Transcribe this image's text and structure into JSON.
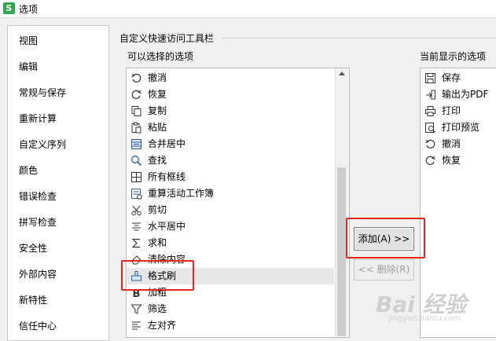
{
  "window": {
    "title": "选项",
    "app_icon_glyph": "S",
    "app_icon_color": "#2fa84f"
  },
  "sidebar": {
    "items": [
      {
        "label": "视图"
      },
      {
        "label": "编辑"
      },
      {
        "label": "常规与保存"
      },
      {
        "label": "重新计算"
      },
      {
        "label": "自定义序列"
      },
      {
        "label": "颜色"
      },
      {
        "label": "错误检查"
      },
      {
        "label": "拼写检查"
      },
      {
        "label": "安全性"
      },
      {
        "label": "外部内容"
      },
      {
        "label": "新特性"
      },
      {
        "label": "信任中心"
      }
    ]
  },
  "panel": {
    "group_title": "自定义快速访问工具栏",
    "available_label": "可以选择的选项",
    "current_label": "当前显示的选项",
    "available_items": [
      {
        "label": "撤消",
        "icon": "undo-icon"
      },
      {
        "label": "恢复",
        "icon": "redo-icon"
      },
      {
        "label": "复制",
        "icon": "copy-icon"
      },
      {
        "label": "粘贴",
        "icon": "paste-icon"
      },
      {
        "label": "合并居中",
        "icon": "merge-center-icon"
      },
      {
        "label": "查找",
        "icon": "search-icon"
      },
      {
        "label": "所有框线",
        "icon": "all-borders-icon"
      },
      {
        "label": "重算活动工作簿",
        "icon": "recalculate-icon"
      },
      {
        "label": "剪切",
        "icon": "cut-icon"
      },
      {
        "label": "水平居中",
        "icon": "align-center-icon"
      },
      {
        "label": "求和",
        "icon": "sum-icon"
      },
      {
        "label": "清除内容",
        "icon": "clear-content-icon"
      },
      {
        "label": "格式刷",
        "icon": "format-painter-icon"
      },
      {
        "label": "加粗",
        "icon": "bold-icon"
      },
      {
        "label": "筛选",
        "icon": "filter-icon"
      },
      {
        "label": "左对齐",
        "icon": "align-left-icon"
      }
    ],
    "current_items": [
      {
        "label": "保存",
        "icon": "save-icon"
      },
      {
        "label": "输出为PDF",
        "icon": "export-pdf-icon"
      },
      {
        "label": "打印",
        "icon": "print-icon"
      },
      {
        "label": "打印预览",
        "icon": "print-preview-icon"
      },
      {
        "label": "撤消",
        "icon": "undo-icon"
      },
      {
        "label": "恢复",
        "icon": "redo-icon"
      }
    ],
    "add_button": "添加(A) >>",
    "remove_button": "<< 删除(R)"
  },
  "watermark": {
    "text": "Bai 经验",
    "sub": "jingyan.baidu.com"
  },
  "colors": {
    "highlight": "#e0281f",
    "selected_row": "#e7e7e7"
  }
}
